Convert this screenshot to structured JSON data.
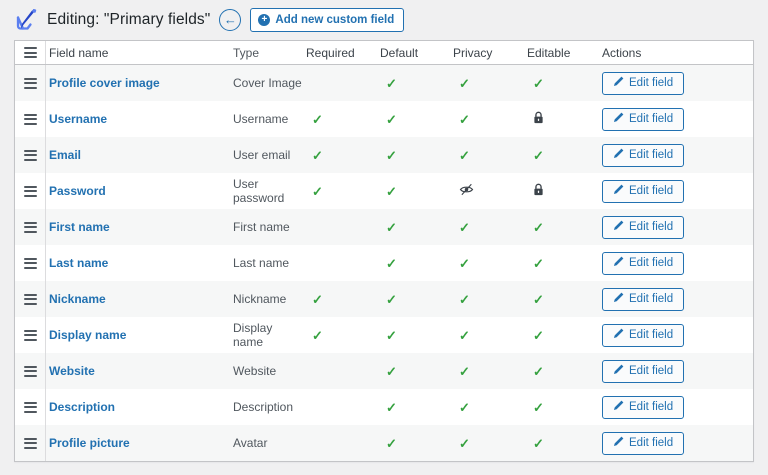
{
  "header": {
    "title": "Editing: \"Primary fields\"",
    "back_label": "←",
    "add_button_label": "Add new custom field"
  },
  "icons": {
    "check_glyph": "✓",
    "plus_glyph": "+"
  },
  "colors": {
    "accent_blue": "#2271b1",
    "check_green": "#35a13f",
    "page_background": "#f0f0f1",
    "stripe_row": "#f6f7f7",
    "table_border": "#c3c4c7"
  },
  "table": {
    "columns": [
      "Field name",
      "Type",
      "Required",
      "Default",
      "Privacy",
      "Editable",
      "Actions"
    ],
    "edit_button_label": "Edit field",
    "rows": [
      {
        "name": "Profile cover image",
        "type": "Cover Image",
        "required": false,
        "default": true,
        "privacy": "check",
        "editable": "check"
      },
      {
        "name": "Username",
        "type": "Username",
        "required": true,
        "default": true,
        "privacy": "check",
        "editable": "lock"
      },
      {
        "name": "Email",
        "type": "User email",
        "required": true,
        "default": true,
        "privacy": "check",
        "editable": "check"
      },
      {
        "name": "Password",
        "type": "User password",
        "required": true,
        "default": true,
        "privacy": "eye-slash",
        "editable": "lock"
      },
      {
        "name": "First name",
        "type": "First name",
        "required": false,
        "default": true,
        "privacy": "check",
        "editable": "check"
      },
      {
        "name": "Last name",
        "type": "Last name",
        "required": false,
        "default": true,
        "privacy": "check",
        "editable": "check"
      },
      {
        "name": "Nickname",
        "type": "Nickname",
        "required": true,
        "default": true,
        "privacy": "check",
        "editable": "check"
      },
      {
        "name": "Display name",
        "type": "Display name",
        "required": true,
        "default": true,
        "privacy": "check",
        "editable": "check"
      },
      {
        "name": "Website",
        "type": "Website",
        "required": false,
        "default": true,
        "privacy": "check",
        "editable": "check"
      },
      {
        "name": "Description",
        "type": "Description",
        "required": false,
        "default": true,
        "privacy": "check",
        "editable": "check"
      },
      {
        "name": "Profile picture",
        "type": "Avatar",
        "required": false,
        "default": true,
        "privacy": "check",
        "editable": "check"
      }
    ]
  }
}
